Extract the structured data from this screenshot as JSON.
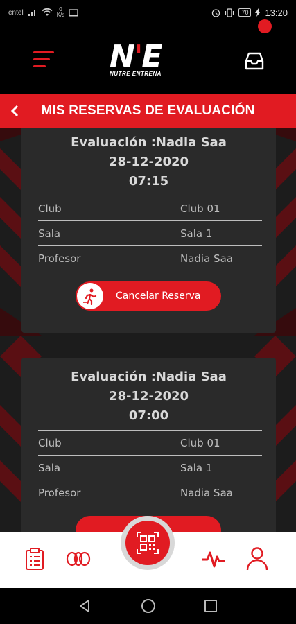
{
  "status": {
    "carrier": "entel",
    "speed": "0\nK/s",
    "battery": "70",
    "time": "13:20"
  },
  "header": {
    "logo_mark_left": "N",
    "logo_mark_right": "E",
    "logo_text": "NUTRE ENTRENA"
  },
  "title_bar": {
    "title": "MIS RESERVAS DE EVALUACIÓN"
  },
  "reservations": [
    {
      "title": "Evaluación :Nadia Saa",
      "date": "28-12-2020",
      "time": "07:15",
      "rows": [
        {
          "label": "Club",
          "value": "Club 01"
        },
        {
          "label": "Sala",
          "value": "Sala 1"
        },
        {
          "label": "Profesor",
          "value": "Nadia Saa"
        }
      ],
      "cancel_label": "Cancelar Reserva"
    },
    {
      "title": "Evaluación :Nadia Saa",
      "date": "28-12-2020",
      "time": "07:00",
      "rows": [
        {
          "label": "Club",
          "value": "Club 01"
        },
        {
          "label": "Sala",
          "value": "Sala 1"
        },
        {
          "label": "Profesor",
          "value": "Nadia Saa"
        }
      ]
    }
  ],
  "bottom_nav": {
    "items": [
      "clipboard-icon",
      "rings-icon",
      "qr-code-icon",
      "heartbeat-icon",
      "user-icon"
    ]
  },
  "colors": {
    "accent": "#e11b22",
    "card": "#2a2a2a",
    "background": "#1c1c1c"
  }
}
